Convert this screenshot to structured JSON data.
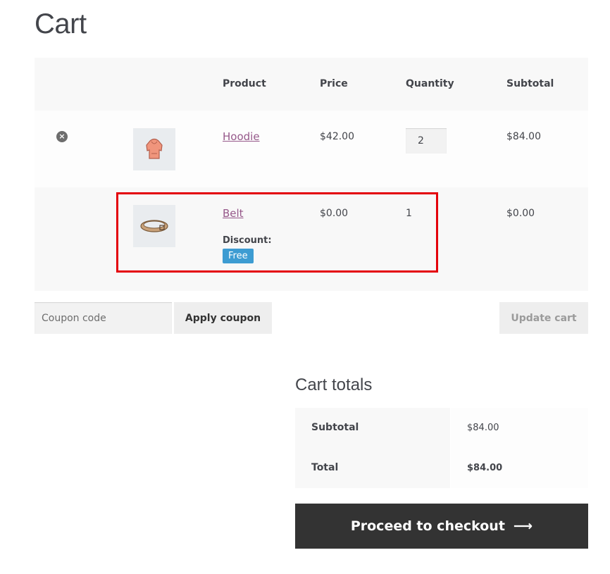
{
  "page": {
    "title": "Cart"
  },
  "table": {
    "headers": {
      "product": "Product",
      "price": "Price",
      "quantity": "Quantity",
      "subtotal": "Subtotal"
    },
    "rows": [
      {
        "name": "Hoodie",
        "price": "$42.00",
        "quantity": "2",
        "subtotal": "$84.00",
        "removable": true
      },
      {
        "name": "Belt",
        "price": "$0.00",
        "quantity": "1",
        "subtotal": "$0.00",
        "discount_label": "Discount:",
        "discount_badge": "Free"
      }
    ]
  },
  "coupon": {
    "placeholder": "Coupon code",
    "apply_label": "Apply coupon"
  },
  "update_label": "Update cart",
  "totals": {
    "title": "Cart totals",
    "subtotal_label": "Subtotal",
    "subtotal_value": "$84.00",
    "total_label": "Total",
    "total_value": "$84.00"
  },
  "checkout": {
    "label": "Proceed to checkout",
    "arrow": "⟶"
  },
  "colors": {
    "link": "#96588a",
    "badge": "#3d9cd2",
    "highlight": "#e4000b",
    "checkout_bg": "#333333"
  },
  "icons": {
    "remove": "remove-icon",
    "arrow": "arrow-right-icon"
  }
}
